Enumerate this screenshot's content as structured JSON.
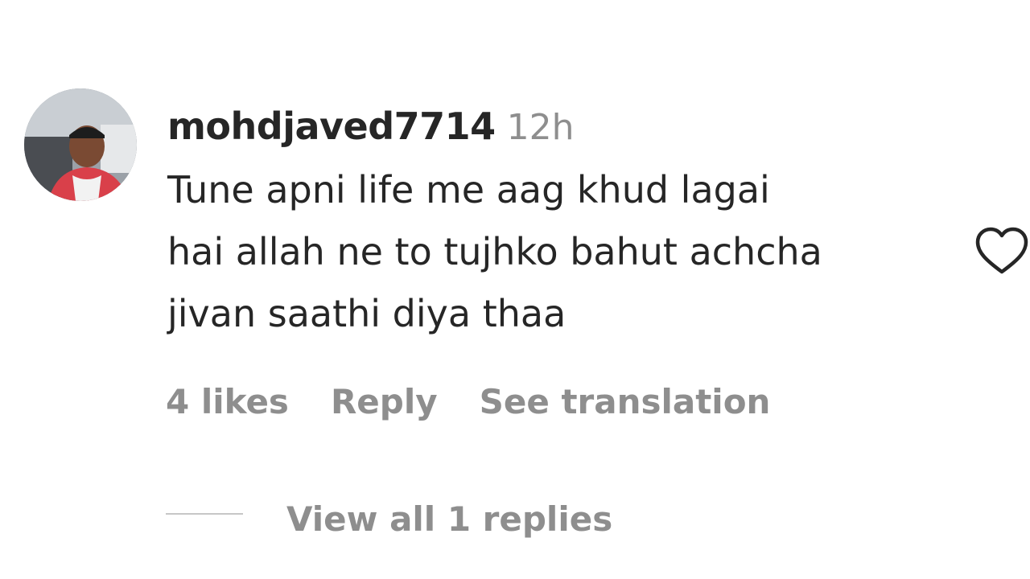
{
  "comment": {
    "username": "mohdjaved7714",
    "timestamp": "12h",
    "text_lines": [
      "Tune apni life me aag khud lagai",
      "hai allah ne to tujhko bahut achcha",
      "jivan saathi diya thaa"
    ],
    "likes": "4 likes",
    "reply_label": "Reply",
    "translation_label": "See translation",
    "view_replies_label": "View all 1 replies",
    "like_icon": "heart-outline-icon"
  },
  "colors": {
    "primary_text": "#262626",
    "secondary_text": "#8e8e8e",
    "divider": "#c7c7c7",
    "background": "#ffffff"
  }
}
